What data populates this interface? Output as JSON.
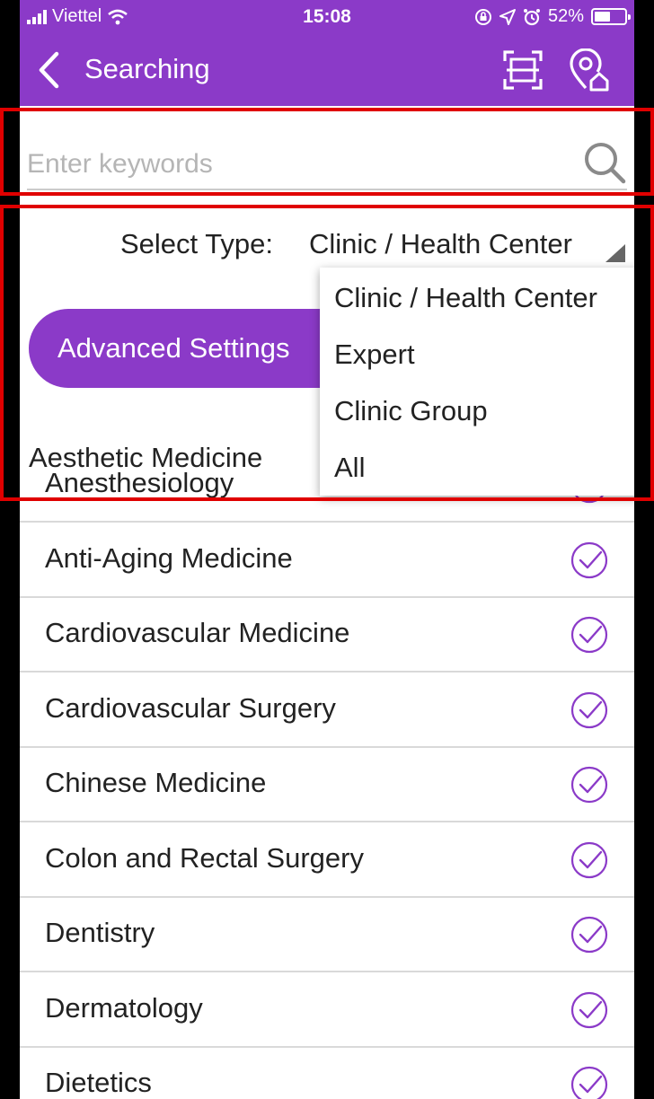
{
  "status_bar": {
    "carrier": "Viettel",
    "time": "15:08",
    "battery": "52%",
    "battery_level": 0.52
  },
  "nav": {
    "title": "Searching",
    "back_icon": "chevron-left-icon",
    "scan_icon": "scan-icon",
    "location_icon": "location-home-icon"
  },
  "search": {
    "placeholder": "Enter keywords",
    "value": "",
    "icon": "search-icon"
  },
  "select_type": {
    "label": "Select Type:",
    "value": "Clinic / Health Center",
    "options": [
      "Clinic / Health Center",
      "Expert",
      "Clinic Group",
      "All"
    ]
  },
  "advanced_settings": {
    "label": "Advanced Settings"
  },
  "section_label": "Aesthetic Medicine",
  "specialties": [
    {
      "label": "Anesthesiology",
      "checked": false
    },
    {
      "label": "Anti-Aging Medicine",
      "checked": false
    },
    {
      "label": "Cardiovascular Medicine",
      "checked": false
    },
    {
      "label": "Cardiovascular Surgery",
      "checked": false
    },
    {
      "label": "Chinese Medicine",
      "checked": false
    },
    {
      "label": "Colon and Rectal Surgery",
      "checked": false
    },
    {
      "label": "Dentistry",
      "checked": false
    },
    {
      "label": "Dermatology",
      "checked": false
    },
    {
      "label": "Dietetics",
      "checked": false
    }
  ],
  "colors": {
    "accent": "#8b3ac8",
    "highlight": "#e00000"
  }
}
